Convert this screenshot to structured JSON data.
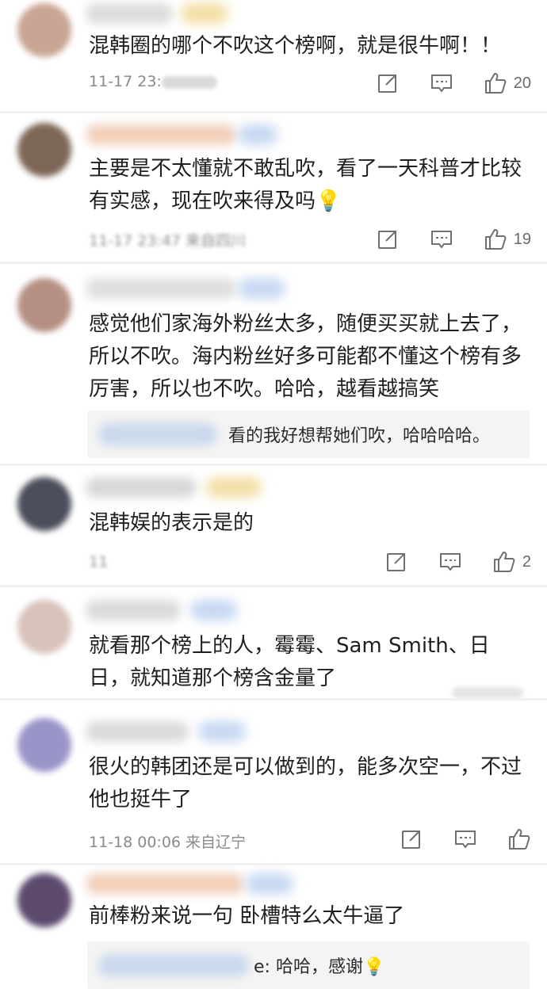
{
  "comments": [
    {
      "text": "混韩圈的哪个不吹这个榜啊，就是很牛啊！！",
      "time": "11-17 23:",
      "likes": "20",
      "avatar_color": "#c9a593"
    },
    {
      "text": "主要是不太懂就不敢乱吹，看了一天科普才比较有实感，现在吹来得及吗💡",
      "time": "11-17 23:47  来自四川",
      "likes": "19",
      "avatar_color": "#7d6657"
    },
    {
      "text": "感觉他们家海外粉丝太多，随便买买就上去了，所以不吹。海内粉丝好多可能都不懂这个榜有多厉害，所以也不吹。哈哈，越看越搞笑",
      "reply": "看的我好想帮她们吹，哈哈哈哈。",
      "avatar_color": "#b48f82"
    },
    {
      "text": "混韩娱的表示是的",
      "time": "11",
      "likes": "2",
      "avatar_color": "#4a4e5a"
    },
    {
      "text": "就看那个榜上的人，霉霉、Sam Smith、日日，就知道那个榜含金量了",
      "avatar_color": "#d8c2bb"
    },
    {
      "text": "很火的韩团还是可以做到的，能多次空一，不过他也挺牛了",
      "time": "11-18 00:06  来自辽宁",
      "avatar_color": "#9a95c9"
    },
    {
      "text": "前棒粉来说一句 卧槽特么太牛逼了",
      "reply": "e: 哈哈，感谢💡",
      "avatar_color": "#5c4a6e"
    }
  ],
  "icons": {
    "share": "share-icon",
    "comment": "comment-icon",
    "like": "thumbs-up-icon"
  }
}
